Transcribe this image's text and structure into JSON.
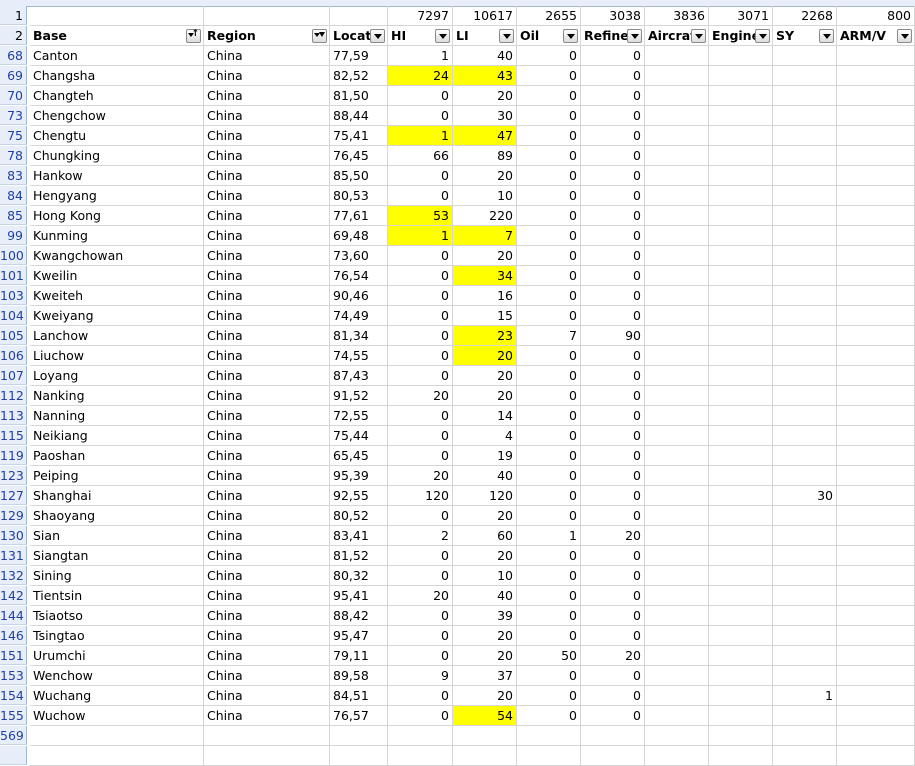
{
  "colors": {
    "highlight": "#ffff00",
    "row_header_text": "#1f3fa5"
  },
  "row1": {
    "row_num": "1",
    "values": [
      "",
      "",
      "",
      "7297",
      "10617",
      "2655",
      "3038",
      "3836",
      "3071",
      "2268",
      "800"
    ]
  },
  "row2": {
    "row_num": "2",
    "headers": [
      "Base",
      "Region",
      "Locatio",
      "HI",
      "LI",
      "Oil",
      "Refiner",
      "Aircraft",
      "Engine",
      "SY",
      "ARM/V"
    ],
    "filter_buttons": [
      "sort-filter",
      "filtered",
      "dropdown",
      "dropdown",
      "dropdown",
      "dropdown",
      "dropdown",
      "dropdown",
      "dropdown",
      "dropdown",
      "dropdown"
    ]
  },
  "rows": [
    {
      "num": "68",
      "base": "Canton",
      "region": "China",
      "loc": "77,59",
      "hi": "1",
      "li": "40",
      "oil": "0",
      "ref": "0",
      "sy": "",
      "hl": []
    },
    {
      "num": "69",
      "base": "Changsha",
      "region": "China",
      "loc": "82,52",
      "hi": "24",
      "li": "43",
      "oil": "0",
      "ref": "0",
      "sy": "",
      "hl": [
        "hi",
        "li"
      ]
    },
    {
      "num": "70",
      "base": "Changteh",
      "region": "China",
      "loc": "81,50",
      "hi": "0",
      "li": "20",
      "oil": "0",
      "ref": "0",
      "sy": "",
      "hl": []
    },
    {
      "num": "73",
      "base": "Chengchow",
      "region": "China",
      "loc": "88,44",
      "hi": "0",
      "li": "30",
      "oil": "0",
      "ref": "0",
      "sy": "",
      "hl": []
    },
    {
      "num": "75",
      "base": "Chengtu",
      "region": "China",
      "loc": "75,41",
      "hi": "1",
      "li": "47",
      "oil": "0",
      "ref": "0",
      "sy": "",
      "hl": [
        "hi",
        "li"
      ]
    },
    {
      "num": "78",
      "base": "Chungking",
      "region": "China",
      "loc": "76,45",
      "hi": "66",
      "li": "89",
      "oil": "0",
      "ref": "0",
      "sy": "",
      "hl": []
    },
    {
      "num": "83",
      "base": "Hankow",
      "region": "China",
      "loc": "85,50",
      "hi": "0",
      "li": "20",
      "oil": "0",
      "ref": "0",
      "sy": "",
      "hl": []
    },
    {
      "num": "84",
      "base": "Hengyang",
      "region": "China",
      "loc": "80,53",
      "hi": "0",
      "li": "10",
      "oil": "0",
      "ref": "0",
      "sy": "",
      "hl": []
    },
    {
      "num": "85",
      "base": "Hong Kong",
      "region": "China",
      "loc": "77,61",
      "hi": "53",
      "li": "220",
      "oil": "0",
      "ref": "0",
      "sy": "",
      "hl": [
        "hi"
      ]
    },
    {
      "num": "99",
      "base": "Kunming",
      "region": "China",
      "loc": "69,48",
      "hi": "1",
      "li": "7",
      "oil": "0",
      "ref": "0",
      "sy": "",
      "hl": [
        "hi",
        "li"
      ]
    },
    {
      "num": "100",
      "base": "Kwangchowan",
      "region": "China",
      "loc": "73,60",
      "hi": "0",
      "li": "20",
      "oil": "0",
      "ref": "0",
      "sy": "",
      "hl": []
    },
    {
      "num": "101",
      "base": "Kweilin",
      "region": "China",
      "loc": "76,54",
      "hi": "0",
      "li": "34",
      "oil": "0",
      "ref": "0",
      "sy": "",
      "hl": [
        "li"
      ]
    },
    {
      "num": "103",
      "base": "Kweiteh",
      "region": "China",
      "loc": "90,46",
      "hi": "0",
      "li": "16",
      "oil": "0",
      "ref": "0",
      "sy": "",
      "hl": []
    },
    {
      "num": "104",
      "base": "Kweiyang",
      "region": "China",
      "loc": "74,49",
      "hi": "0",
      "li": "15",
      "oil": "0",
      "ref": "0",
      "sy": "",
      "hl": []
    },
    {
      "num": "105",
      "base": "Lanchow",
      "region": "China",
      "loc": "81,34",
      "hi": "0",
      "li": "23",
      "oil": "7",
      "ref": "90",
      "sy": "",
      "hl": [
        "li"
      ]
    },
    {
      "num": "106",
      "base": "Liuchow",
      "region": "China",
      "loc": "74,55",
      "hi": "0",
      "li": "20",
      "oil": "0",
      "ref": "0",
      "sy": "",
      "hl": [
        "li"
      ]
    },
    {
      "num": "107",
      "base": "Loyang",
      "region": "China",
      "loc": "87,43",
      "hi": "0",
      "li": "20",
      "oil": "0",
      "ref": "0",
      "sy": "",
      "hl": []
    },
    {
      "num": "112",
      "base": "Nanking",
      "region": "China",
      "loc": "91,52",
      "hi": "20",
      "li": "20",
      "oil": "0",
      "ref": "0",
      "sy": "",
      "hl": []
    },
    {
      "num": "113",
      "base": "Nanning",
      "region": "China",
      "loc": "72,55",
      "hi": "0",
      "li": "14",
      "oil": "0",
      "ref": "0",
      "sy": "",
      "hl": []
    },
    {
      "num": "115",
      "base": "Neikiang",
      "region": "China",
      "loc": "75,44",
      "hi": "0",
      "li": "4",
      "oil": "0",
      "ref": "0",
      "sy": "",
      "hl": []
    },
    {
      "num": "119",
      "base": "Paoshan",
      "region": "China",
      "loc": "65,45",
      "hi": "0",
      "li": "19",
      "oil": "0",
      "ref": "0",
      "sy": "",
      "hl": []
    },
    {
      "num": "123",
      "base": "Peiping",
      "region": "China",
      "loc": "95,39",
      "hi": "20",
      "li": "40",
      "oil": "0",
      "ref": "0",
      "sy": "",
      "hl": []
    },
    {
      "num": "127",
      "base": "Shanghai",
      "region": "China",
      "loc": "92,55",
      "hi": "120",
      "li": "120",
      "oil": "0",
      "ref": "0",
      "sy": "30",
      "hl": []
    },
    {
      "num": "129",
      "base": "Shaoyang",
      "region": "China",
      "loc": "80,52",
      "hi": "0",
      "li": "20",
      "oil": "0",
      "ref": "0",
      "sy": "",
      "hl": []
    },
    {
      "num": "130",
      "base": "Sian",
      "region": "China",
      "loc": "83,41",
      "hi": "2",
      "li": "60",
      "oil": "1",
      "ref": "20",
      "sy": "",
      "hl": []
    },
    {
      "num": "131",
      "base": "Siangtan",
      "region": "China",
      "loc": "81,52",
      "hi": "0",
      "li": "20",
      "oil": "0",
      "ref": "0",
      "sy": "",
      "hl": []
    },
    {
      "num": "132",
      "base": "Sining",
      "region": "China",
      "loc": "80,32",
      "hi": "0",
      "li": "10",
      "oil": "0",
      "ref": "0",
      "sy": "",
      "hl": []
    },
    {
      "num": "142",
      "base": "Tientsin",
      "region": "China",
      "loc": "95,41",
      "hi": "20",
      "li": "40",
      "oil": "0",
      "ref": "0",
      "sy": "",
      "hl": []
    },
    {
      "num": "144",
      "base": "Tsiaotso",
      "region": "China",
      "loc": "88,42",
      "hi": "0",
      "li": "39",
      "oil": "0",
      "ref": "0",
      "sy": "",
      "hl": []
    },
    {
      "num": "146",
      "base": "Tsingtao",
      "region": "China",
      "loc": "95,47",
      "hi": "0",
      "li": "20",
      "oil": "0",
      "ref": "0",
      "sy": "",
      "hl": []
    },
    {
      "num": "151",
      "base": "Urumchi",
      "region": "China",
      "loc": "79,11",
      "hi": "0",
      "li": "20",
      "oil": "50",
      "ref": "20",
      "sy": "",
      "hl": []
    },
    {
      "num": "153",
      "base": "Wenchow",
      "region": "China",
      "loc": "89,58",
      "hi": "9",
      "li": "37",
      "oil": "0",
      "ref": "0",
      "sy": "",
      "hl": []
    },
    {
      "num": "154",
      "base": "Wuchang",
      "region": "China",
      "loc": "84,51",
      "hi": "0",
      "li": "20",
      "oil": "0",
      "ref": "0",
      "sy": "1",
      "hl": []
    },
    {
      "num": "155",
      "base": "Wuchow",
      "region": "China",
      "loc": "76,57",
      "hi": "0",
      "li": "54",
      "oil": "0",
      "ref": "0",
      "sy": "",
      "hl": [
        "li"
      ]
    }
  ],
  "last_row": {
    "num": "569"
  }
}
